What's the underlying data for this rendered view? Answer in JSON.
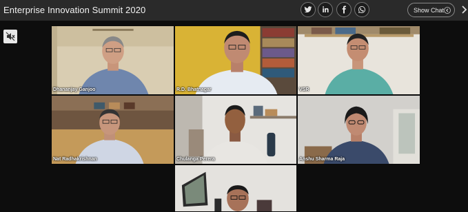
{
  "header": {
    "title": "Enterprise Innovation Summit 2020",
    "share_icons": [
      "twitter-icon",
      "linkedin-icon",
      "facebook-icon",
      "whatsapp-icon"
    ],
    "show_chat_label": "Show Chat"
  },
  "controls": {
    "mute_icon": "speaker-muted-icon"
  },
  "participants": [
    {
      "name": "Dhananjay Ganjoo"
    },
    {
      "name": "R.D. Bhatnagar"
    },
    {
      "name": "VSR"
    },
    {
      "name": "Nat Radhakrishnan"
    },
    {
      "name": "Chulanga Perera"
    },
    {
      "name": "Anshu Sharma Raja"
    },
    {
      "name": ""
    }
  ],
  "colors": {
    "topbar": "#2a2a2a",
    "background": "#0d0d0d"
  }
}
